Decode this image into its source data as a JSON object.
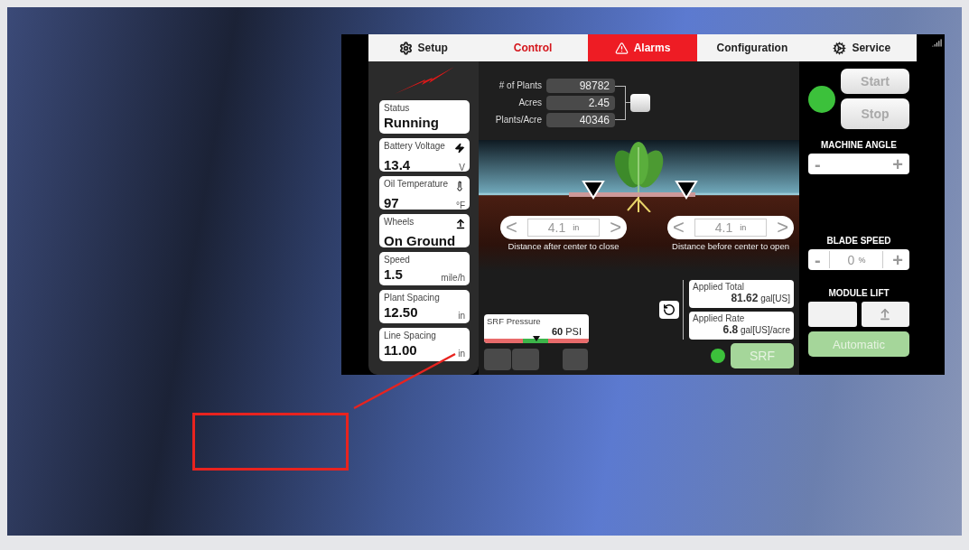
{
  "tabs": [
    {
      "label": "Setup",
      "kind": "gear",
      "selected": false,
      "alert": false
    },
    {
      "label": "Control",
      "kind": "plain",
      "selected": true,
      "alert": false
    },
    {
      "label": "Alarms",
      "kind": "warning",
      "selected": false,
      "alert": true
    },
    {
      "label": "Configuration",
      "kind": "plain",
      "selected": false,
      "alert": false
    },
    {
      "label": "Service",
      "kind": "cog",
      "selected": false,
      "alert": false
    }
  ],
  "status_cards": [
    {
      "label": "Status",
      "value": "Running",
      "kind": "plain"
    },
    {
      "label": "Battery Voltage",
      "value": "13.4",
      "unit": "V",
      "kind": "bolt"
    },
    {
      "label": "Oil Temperature",
      "value": "97",
      "unit": "°F",
      "kind": "thermometer"
    },
    {
      "label": "Wheels",
      "value": "On Ground",
      "kind": "lift"
    },
    {
      "label": "Speed",
      "value": "1.5",
      "unit": "mile/h",
      "kind": "plain"
    },
    {
      "label": "Plant Spacing",
      "value": "12.50",
      "unit": "in",
      "kind": "plain"
    },
    {
      "label": "Line Spacing",
      "value": "11.00",
      "unit": "in",
      "kind": "plain"
    }
  ],
  "counters": [
    {
      "label": "# of Plants",
      "value": "98782"
    },
    {
      "label": "Acres",
      "value": "2.45"
    },
    {
      "label": "Plants/Acre",
      "value": "40346"
    }
  ],
  "distance_controls": [
    {
      "prev": "<",
      "value": "4.1",
      "unit": "in",
      "next": ">",
      "caption": "Distance after center to close"
    },
    {
      "prev": "<",
      "value": "4.1",
      "unit": "in",
      "next": ">",
      "caption": "Distance before center to open"
    }
  ],
  "srf_pressure": {
    "label": "SRF Pressure",
    "value": "60",
    "unit": "PSI",
    "level": 0.5
  },
  "applied": [
    {
      "label": "Applied Total",
      "value": "81.62",
      "unit": "gal[US]"
    },
    {
      "label": "Applied Rate",
      "value": "6.8",
      "unit": "gal[US]/acre"
    }
  ],
  "srf": {
    "label": "SRF",
    "on": true
  },
  "machine": {
    "running": true,
    "start": "Start",
    "stop": "Stop"
  },
  "machine_angle": {
    "title": "MACHINE ANGLE",
    "minus": "-",
    "plus": "+"
  },
  "blade_speed": {
    "title": "BLADE SPEED",
    "minus": "-",
    "value": "0",
    "unit": "%",
    "plus": "+"
  },
  "module_lift": {
    "title": "MODULE LIFT",
    "automatic": "Automatic"
  }
}
